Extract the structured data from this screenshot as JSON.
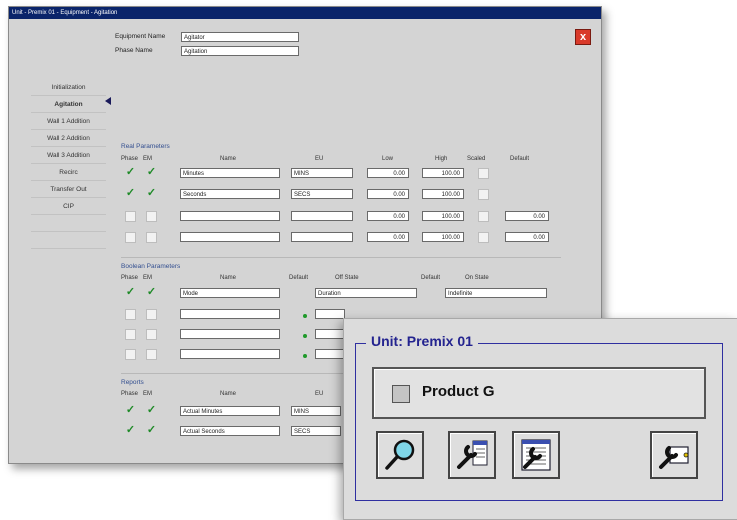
{
  "back_window": {
    "title": "Unit - Premix 01 - Equipment - Agitation",
    "close_label": "x",
    "equipment_name_label": "Equipment Name",
    "equipment_name_value": "Agitator",
    "phase_name_label": "Phase Name",
    "phase_name_value": "Agitation",
    "nav_items": [
      "Initialization",
      "Agitation",
      "Wall 1 Addition",
      "Wall 2 Addition",
      "Wall 3 Addition",
      "Recirc",
      "Transfer Out",
      "CIP"
    ],
    "real_params": {
      "title": "Real Parameters",
      "headers": {
        "phase": "Phase",
        "em": "EM",
        "name": "Name",
        "eu": "EU",
        "low": "Low",
        "high": "High",
        "scaled": "Scaled",
        "default": "Default"
      },
      "rows": [
        {
          "name": "Minutes",
          "eu": "MINS",
          "low": "0.00",
          "high": "100.00",
          "default": ""
        },
        {
          "name": "Seconds",
          "eu": "SECS",
          "low": "0.00",
          "high": "100.00",
          "default": ""
        },
        {
          "name": "",
          "eu": "",
          "low": "0.00",
          "high": "100.00",
          "default": "0.00"
        },
        {
          "name": "",
          "eu": "",
          "low": "0.00",
          "high": "100.00",
          "default": "0.00"
        }
      ]
    },
    "bool_params": {
      "title": "Boolean Parameters",
      "headers": {
        "phase": "Phase",
        "em": "EM",
        "name": "Name",
        "default": "Default",
        "off_state": "Off State",
        "on_state": "On State"
      },
      "rows": [
        {
          "name": "Mode",
          "off_state": "Duration",
          "on_state": "Indefinite"
        }
      ]
    },
    "reports": {
      "title": "Reports",
      "headers": {
        "phase": "Phase",
        "em": "EM",
        "name": "Name",
        "eu": "EU"
      },
      "rows": [
        {
          "name": "Actual Minutes",
          "eu": "MINS"
        },
        {
          "name": "Actual Seconds",
          "eu": "SECS"
        }
      ]
    }
  },
  "front_panel": {
    "group_title": "Unit: Premix 01",
    "product_button": "Product G",
    "icons": [
      "magnifier-icon",
      "wrench-config-icon",
      "wrench-list-icon",
      "wrench-device-icon"
    ]
  },
  "colors": {
    "check": "#1f8a28",
    "group_border": "#2f2fa0",
    "title_blue": "#23238f",
    "close_red": "#d93a2a"
  }
}
